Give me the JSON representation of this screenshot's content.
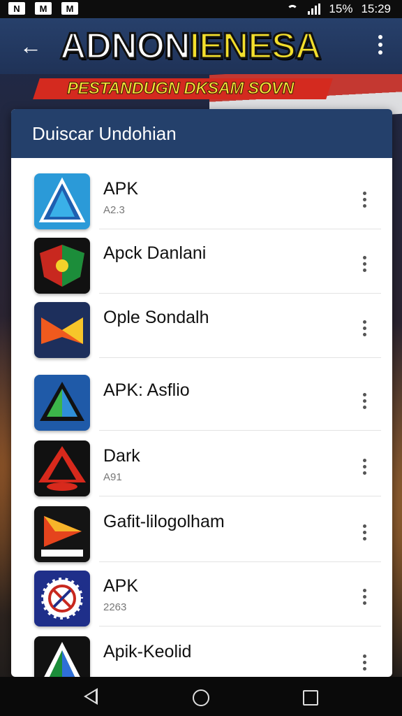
{
  "status_bar": {
    "notif_icons": [
      "N",
      "M",
      "M"
    ],
    "battery": "15%",
    "time": "15:29"
  },
  "app_bar": {
    "title_part1": "ADNON",
    "title_part2": "IENESA",
    "accent": "#f2de2c"
  },
  "banner": {
    "text": "PESTANDUGN DKSAM SOVN"
  },
  "panel": {
    "heading": "Duiscar Undohian"
  },
  "apps": [
    {
      "name": "APK",
      "sub": "A2.3",
      "icon": "app-drive-icon"
    },
    {
      "name": "Apck Danlani",
      "sub": "",
      "icon": "app-shield-icon"
    },
    {
      "name": "Ople Sondalh",
      "sub": "",
      "icon": "app-m-icon"
    },
    {
      "name": "APK: Asflio",
      "sub": "",
      "icon": "app-triangle-icon"
    },
    {
      "name": "Dark",
      "sub": "A91",
      "icon": "app-dark-icon"
    },
    {
      "name": "Gafit-lilogolham",
      "sub": "",
      "icon": "app-play-icon"
    },
    {
      "name": "APK",
      "sub": "2263",
      "icon": "app-gear-icon"
    },
    {
      "name": "Apik-Keolid",
      "sub": "",
      "icon": "app-keolid-icon"
    }
  ]
}
